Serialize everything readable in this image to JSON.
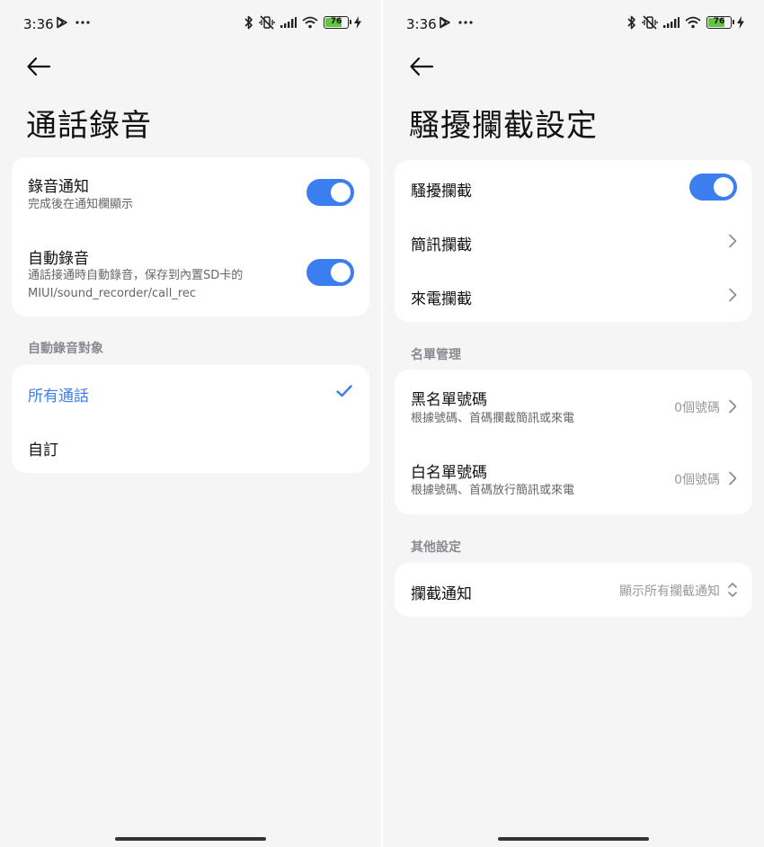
{
  "left_screen": {
    "status": {
      "time": "3:36",
      "battery": "76",
      "battery_level": 0.76
    },
    "title": "通話錄音",
    "settings": [
      {
        "title": "錄音通知",
        "subtitle": "完成後在通知欄顯示",
        "toggle": true
      },
      {
        "title": "自動錄音",
        "subtitle": "通話接通時自動錄音，保存到內置SD卡的\nMIUI/sound_recorder/call_rec",
        "toggle": true
      }
    ],
    "section_label": "自動錄音對象",
    "options": [
      {
        "label": "所有通話",
        "selected": true
      },
      {
        "label": "自訂",
        "selected": false
      }
    ]
  },
  "right_screen": {
    "status": {
      "time": "3:36",
      "battery": "76",
      "battery_level": 0.76
    },
    "title": "騷擾攔截設定",
    "main": [
      {
        "title": "騷擾攔截",
        "toggle": true
      },
      {
        "title": "簡訊攔截"
      },
      {
        "title": "來電攔截"
      }
    ],
    "list_section_label": "名單管理",
    "lists": [
      {
        "title": "黑名單號碼",
        "subtitle": "根據號碼、首碼攔截簡訊或來電",
        "value": "0個號碼"
      },
      {
        "title": "白名單號碼",
        "subtitle": "根據號碼、首碼放行簡訊或來電",
        "value": "0個號碼"
      }
    ],
    "other_section_label": "其他設定",
    "notify": {
      "title": "攔截通知",
      "value": "顯示所有攔截通知"
    }
  },
  "colors": {
    "accent": "#3a7ef0",
    "battery": "#62c344",
    "background": "#f5f5f5",
    "card": "#ffffff"
  }
}
